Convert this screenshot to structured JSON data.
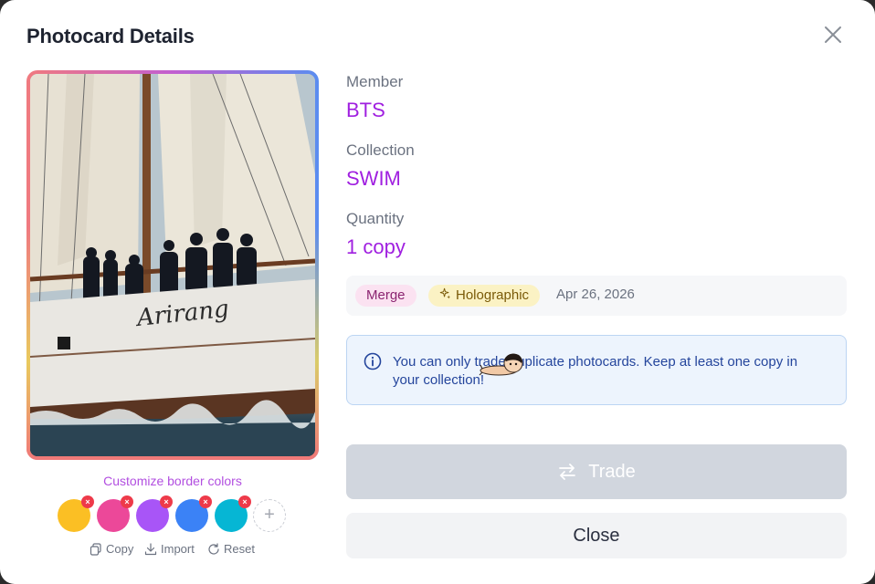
{
  "modal": {
    "title": "Photocard Details"
  },
  "card": {
    "image_alt": "Photocard: group on sailboat deck",
    "ship_name": "Arirang"
  },
  "border": {
    "customize_label": "Customize border colors",
    "colors": [
      "#fbbf24",
      "#ec4899",
      "#a855f7",
      "#3b82f6",
      "#06b6d4"
    ],
    "remove_glyph": "×",
    "add_glyph": "+",
    "actions": {
      "copy": "Copy",
      "import": "Import",
      "reset": "Reset"
    }
  },
  "details": {
    "member_label": "Member",
    "member_value": "BTS",
    "collection_label": "Collection",
    "collection_value": "SWIM",
    "quantity_label": "Quantity",
    "quantity_value": "1 copy"
  },
  "meta": {
    "badge_merge": "Merge",
    "badge_holographic": "Holographic",
    "date": "Apr 26, 2026"
  },
  "notice": {
    "text": "You can only trade duplicate photocards. Keep at least one copy in your collection!"
  },
  "buttons": {
    "trade": "Trade",
    "close": "Close"
  },
  "colors": {
    "accent": "#a020e0",
    "trade_disabled": "#d1d6de",
    "notice_bg": "#edf4fd"
  }
}
